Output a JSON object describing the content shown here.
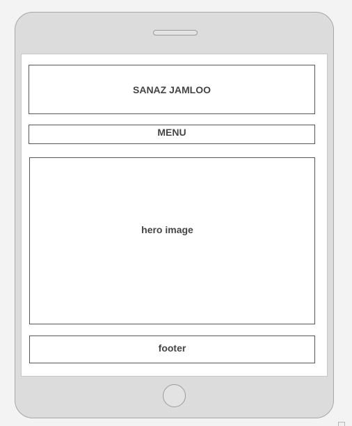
{
  "mockup": {
    "header_text": "SANAZ JAMLOO",
    "menu_text": "MENU",
    "hero_text": "hero image",
    "footer_text": "footer"
  },
  "colors": {
    "device_body": "#dcdcdc",
    "device_border": "#a6a6a6",
    "screen_background": "#ffffff",
    "box_border": "#555555",
    "text": "#444444"
  }
}
